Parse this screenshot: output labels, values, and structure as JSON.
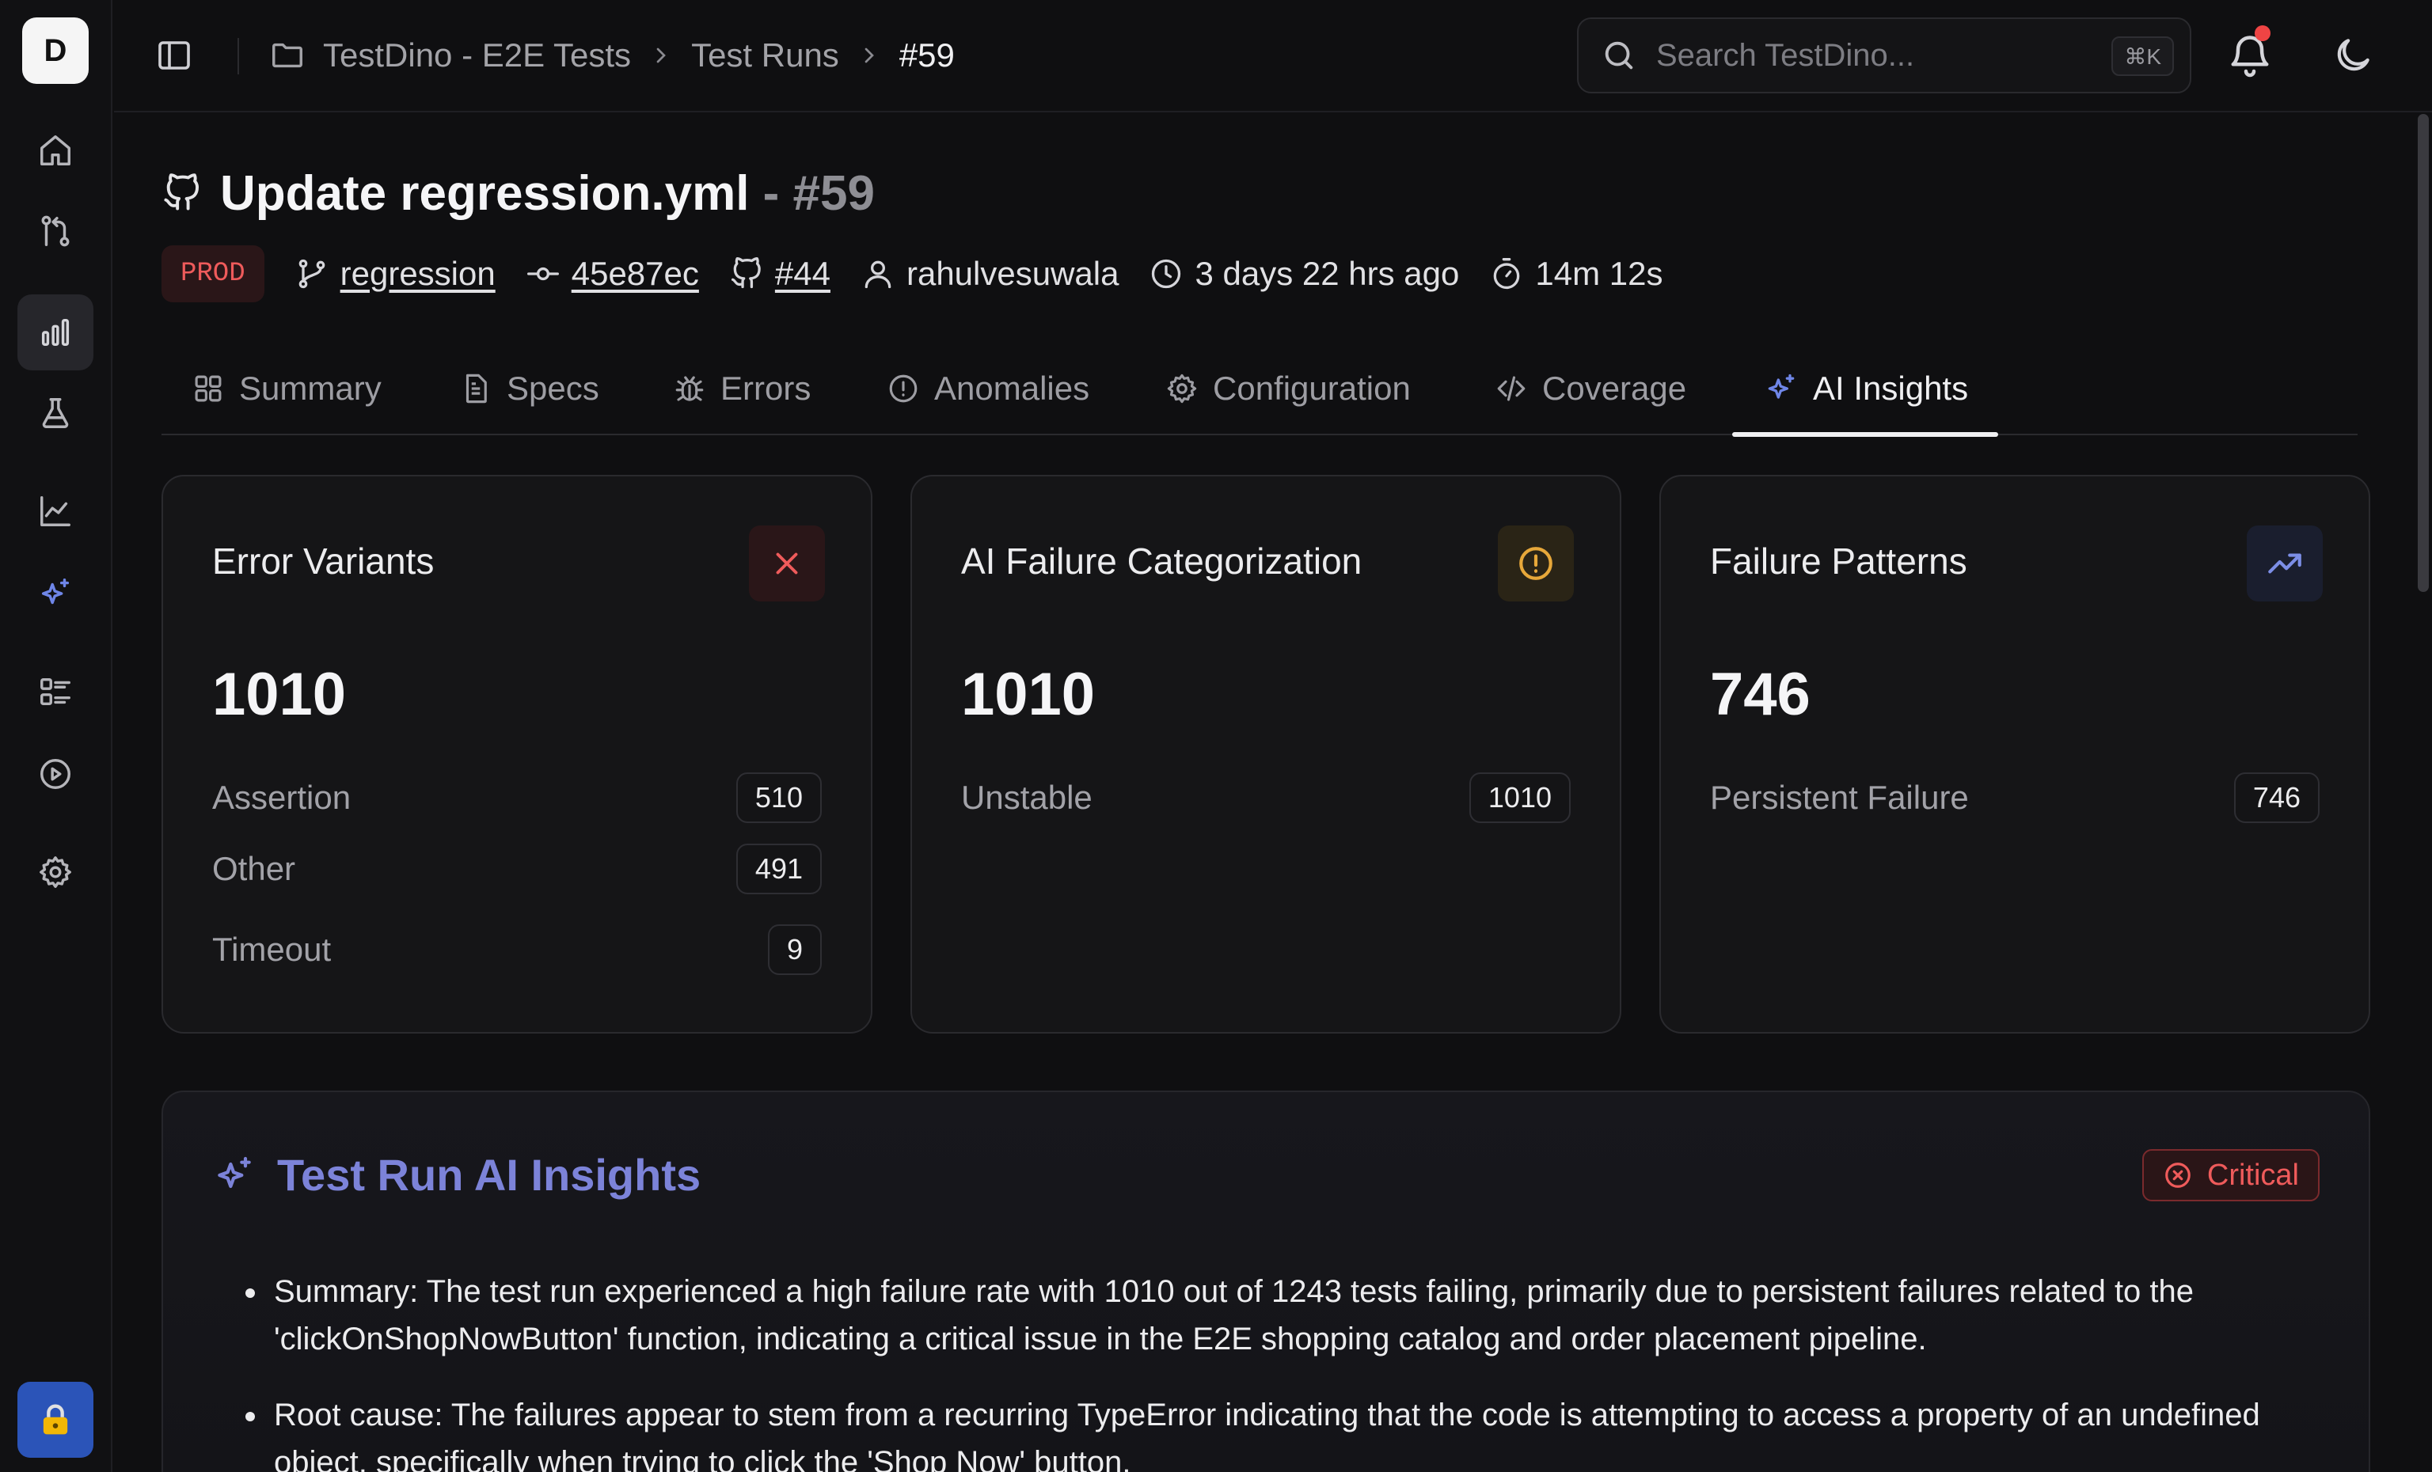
{
  "rail": {
    "logo": "D",
    "items": [
      {
        "icon": "home-icon"
      },
      {
        "icon": "git-compare-icon"
      },
      {
        "icon": "bar-chart-icon",
        "active": true
      },
      {
        "icon": "flask-icon"
      },
      {
        "icon": "line-chart-icon"
      },
      {
        "icon": "sparkles-icon"
      },
      {
        "icon": "list-checks-icon"
      },
      {
        "icon": "play-circle-icon"
      },
      {
        "icon": "settings-icon"
      }
    ],
    "lock_icon": "lock-icon"
  },
  "topbar": {
    "breadcrumb": [
      "TestDino - E2E Tests",
      "Test Runs",
      "#59"
    ],
    "search_placeholder": "Search TestDino...",
    "search_shortcut": "⌘K",
    "notification_dot": true
  },
  "run": {
    "title": "Update regression.yml",
    "number": "- #59",
    "env": "PROD",
    "branch": "regression",
    "commit": "45e87ec",
    "pr": "#44",
    "author": "rahulvesuwala",
    "time_ago": "3 days 22 hrs ago",
    "duration": "14m 12s"
  },
  "tabs": [
    "Summary",
    "Specs",
    "Errors",
    "Anomalies",
    "Configuration",
    "Coverage",
    "AI Insights"
  ],
  "active_tab": "AI Insights",
  "cards": [
    {
      "title": "Error Variants",
      "value": "1010",
      "rows": [
        {
          "label": "Assertion",
          "count": "510"
        },
        {
          "label": "Other",
          "count": "491"
        },
        {
          "label": "Timeout",
          "count": "9"
        }
      ]
    },
    {
      "title": "AI Failure Categorization",
      "value": "1010",
      "rows": [
        {
          "label": "Unstable",
          "count": "1010"
        }
      ]
    },
    {
      "title": "Failure Patterns",
      "value": "746",
      "rows": [
        {
          "label": "Persistent Failure",
          "count": "746"
        }
      ]
    }
  ],
  "insights": {
    "title": "Test Run AI Insights",
    "severity": "Critical",
    "items": [
      "Summary: The test run experienced a high failure rate with 1010 out of 1243 tests failing, primarily due to persistent failures related to the 'clickOnShopNowButton' function, indicating a critical issue in the E2E shopping catalog and order placement pipeline.",
      "Root cause: The failures appear to stem from a recurring TypeError indicating that the code is attempting to access a property of an undefined object, specifically when trying to click the 'Shop Now' button."
    ]
  },
  "colors": {
    "accent": "#7c83d9",
    "danger": "#ef5b5b",
    "warning": "#e7a83a",
    "trend": "#7c8ee6"
  }
}
